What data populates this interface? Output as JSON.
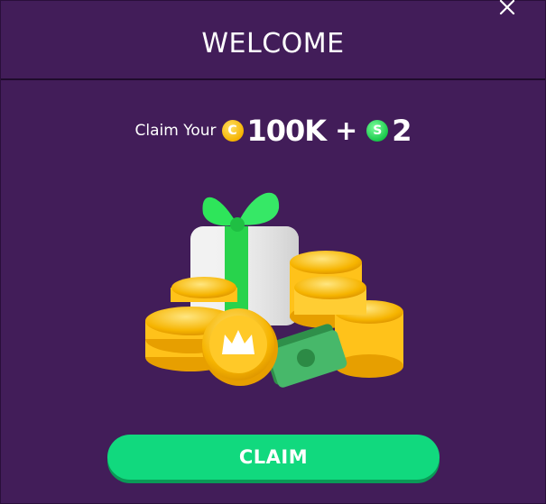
{
  "modal": {
    "title": "WELCOME",
    "close_icon": "close-icon",
    "claim_text": "Claim Your",
    "gold_coin_letter": "C",
    "gold_amount": "100K",
    "plus": "+",
    "sweeps_coin_letter": "S",
    "sweeps_amount": "2",
    "claim_button": "CLAIM"
  },
  "colors": {
    "background": "#421d59",
    "button": "#11d97e",
    "gold": "#f5b300",
    "green": "#19c94b"
  },
  "hero_image": "gift-box-coins-cash-illustration"
}
